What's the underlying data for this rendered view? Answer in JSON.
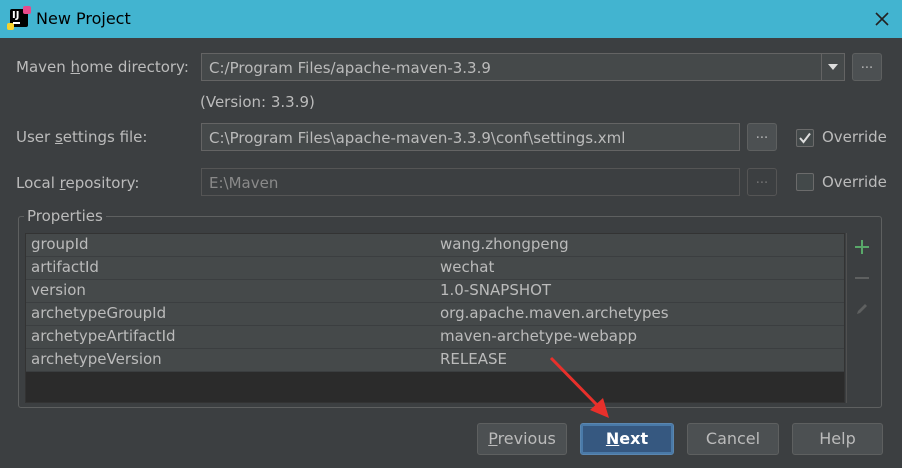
{
  "window": {
    "title": "New Project"
  },
  "maven_home": {
    "label_pre": "Maven ",
    "label_mnemonic": "h",
    "label_post": "ome directory:",
    "value": "C:/Program Files/apache-maven-3.3.9",
    "browse_label": "...",
    "version_text": "(Version: 3.3.9)"
  },
  "user_settings": {
    "label_pre": "User ",
    "label_mnemonic": "s",
    "label_post": "ettings file:",
    "value": "C:\\Program Files\\apache-maven-3.3.9\\conf\\settings.xml",
    "browse_label": "...",
    "override_label": "Override",
    "override_checked": true
  },
  "local_repo": {
    "label_pre": "Local ",
    "label_mnemonic": "r",
    "label_post": "epository:",
    "value": "E:\\Maven",
    "browse_label": "...",
    "override_label": "Override",
    "override_checked": false
  },
  "properties": {
    "title": "Properties",
    "rows": [
      {
        "key": "groupId",
        "value": "wang.zhongpeng"
      },
      {
        "key": "artifactId",
        "value": "wechat"
      },
      {
        "key": "version",
        "value": "1.0-SNAPSHOT"
      },
      {
        "key": "archetypeGroupId",
        "value": "org.apache.maven.archetypes"
      },
      {
        "key": "archetypeArtifactId",
        "value": "maven-archetype-webapp"
      },
      {
        "key": "archetypeVersion",
        "value": "RELEASE"
      }
    ],
    "toolbar_icons": [
      "add-icon",
      "remove-icon",
      "edit-icon"
    ]
  },
  "buttons": {
    "previous": {
      "mnemonic": "P",
      "rest": "revious"
    },
    "next": {
      "mnemonic": "N",
      "rest": "ext"
    },
    "cancel": "Cancel",
    "help": "Help"
  },
  "colors": {
    "titlebar": "#42b4d0",
    "dialog_bg": "#3c3f41",
    "primary_button": "#365880",
    "annotation_arrow": "#e8302b",
    "add_icon": "#59a869"
  }
}
